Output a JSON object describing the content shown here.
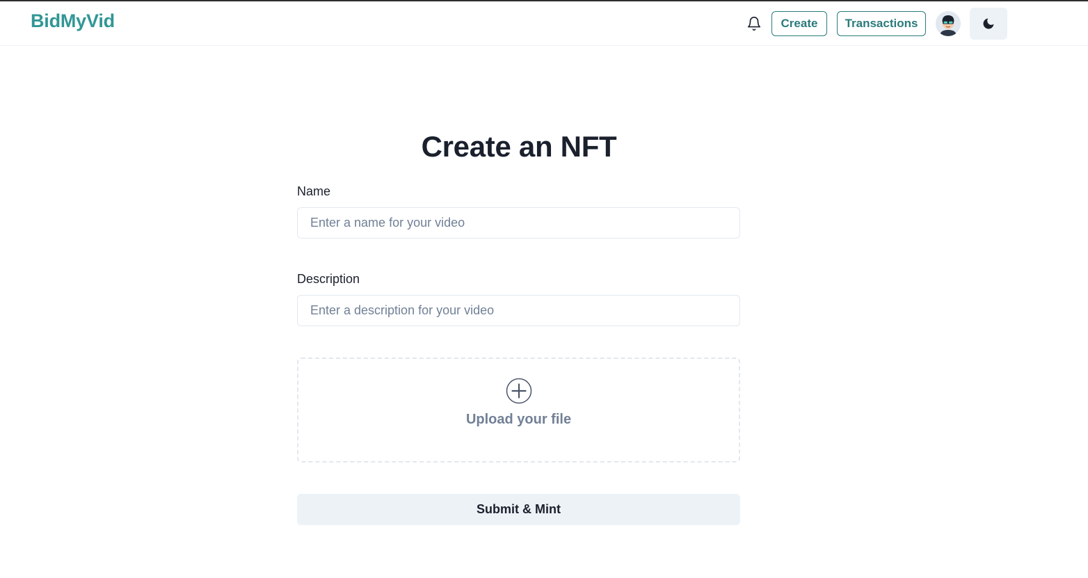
{
  "header": {
    "brand": "BidMyVid",
    "create_label": "Create",
    "transactions_label": "Transactions",
    "icons": {
      "notifications": "bell-icon",
      "avatar": "avatar",
      "theme_toggle": "moon-icon"
    }
  },
  "main": {
    "title": "Create an NFT",
    "name_field": {
      "label": "Name",
      "value": "",
      "placeholder": "Enter a name for your video"
    },
    "description_field": {
      "label": "Description",
      "value": "",
      "placeholder": "Enter a description for your video"
    },
    "upload": {
      "label": "Upload your file",
      "icon": "plus-circle-icon"
    },
    "submit_label": "Submit & Mint"
  },
  "colors": {
    "brand": "#319795",
    "accent": "#2c7a7b",
    "muted_text": "#718096",
    "button_bg": "#edf2f7",
    "border": "#e2e8f0"
  }
}
